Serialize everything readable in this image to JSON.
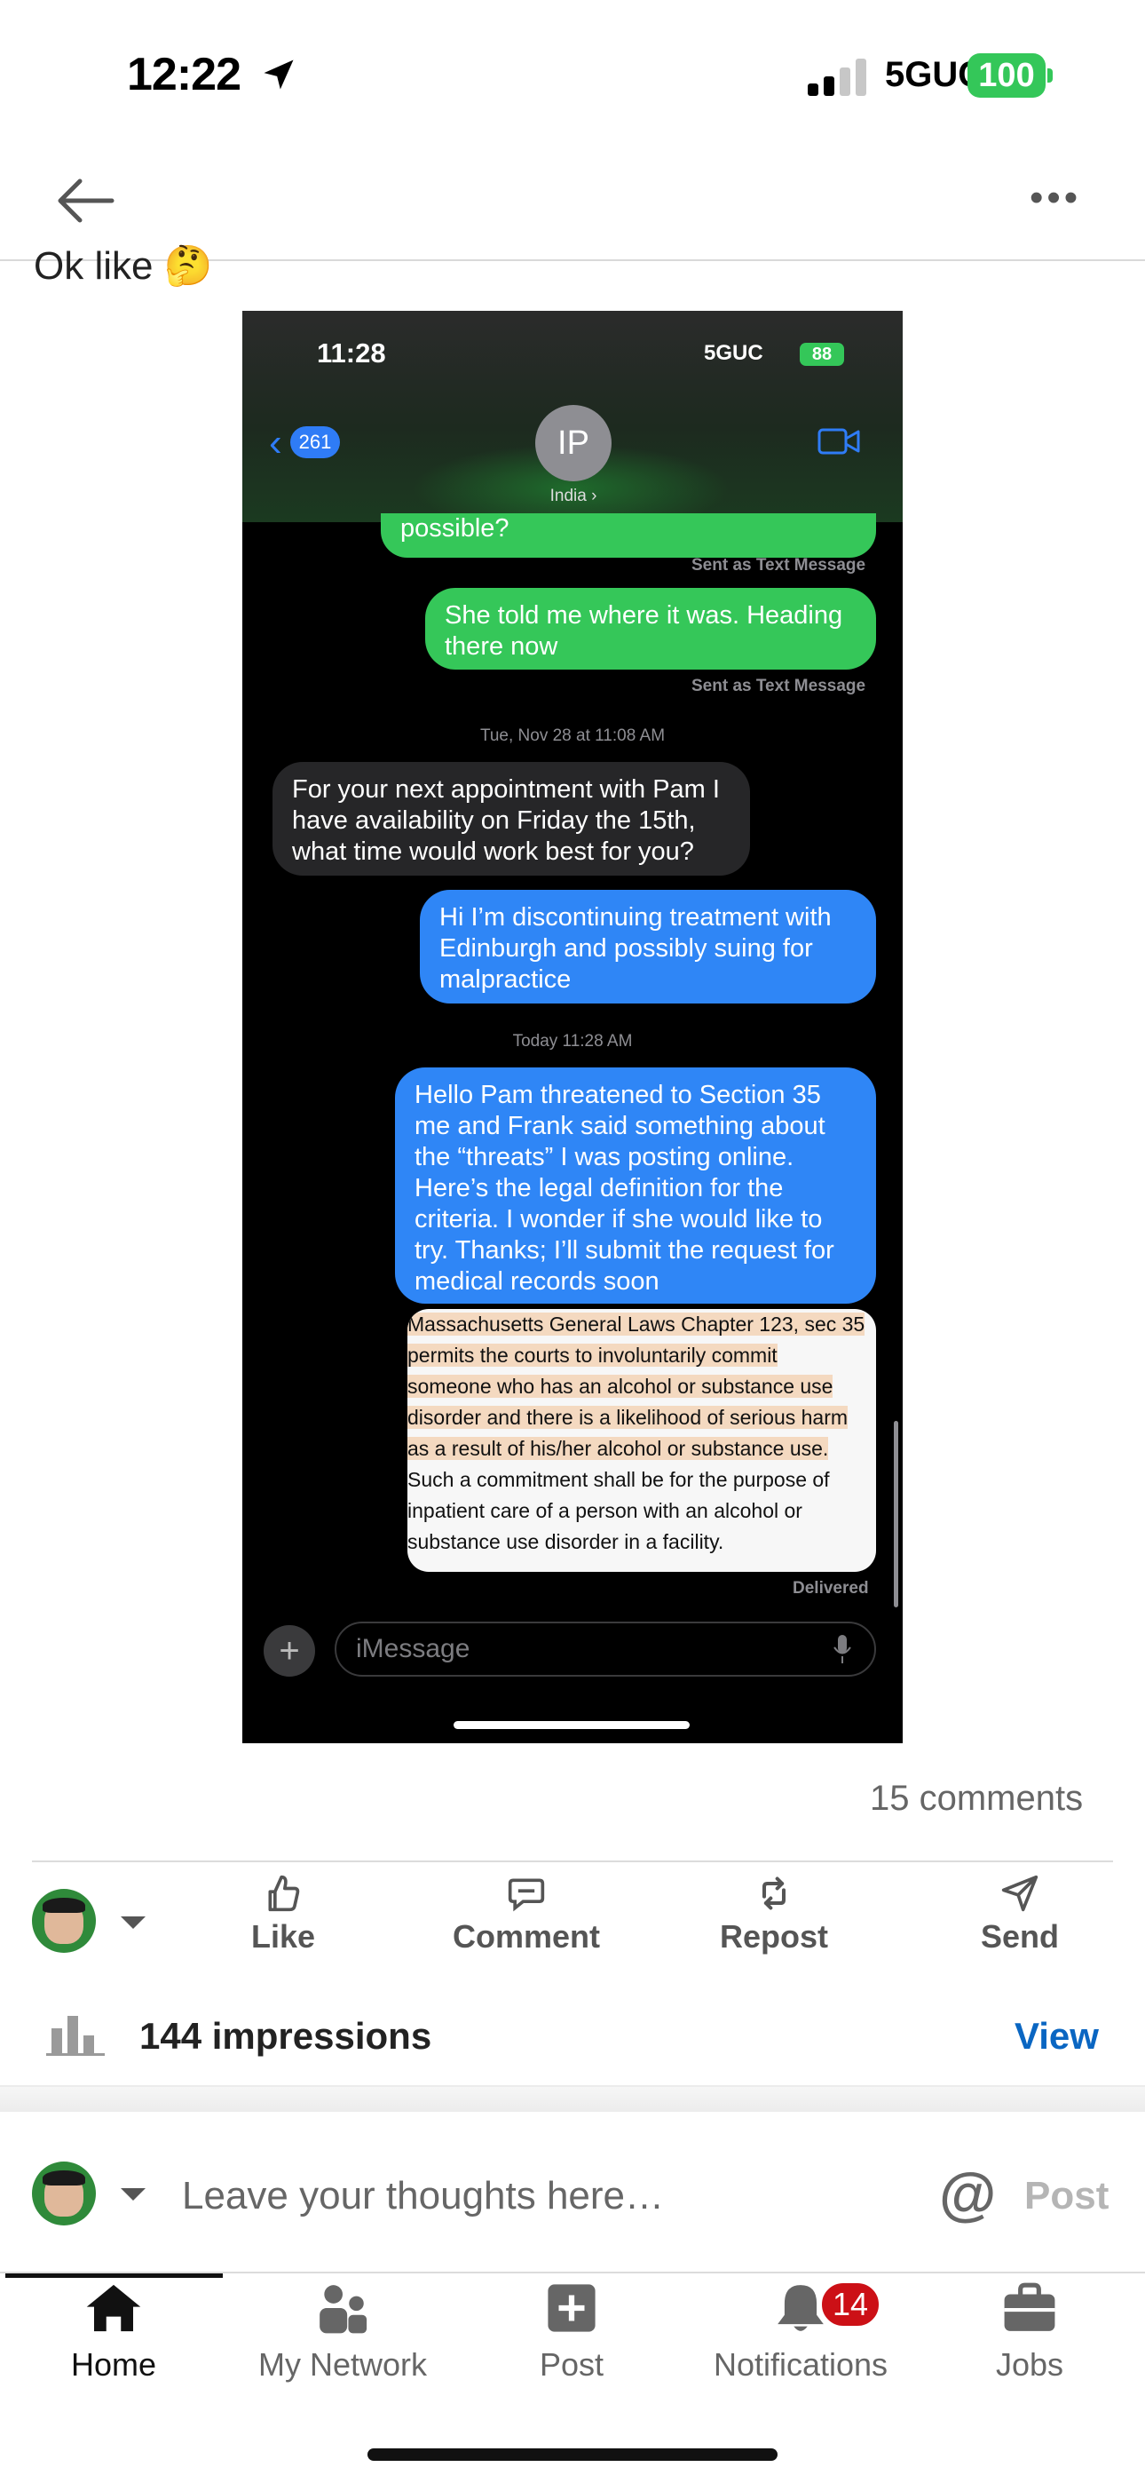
{
  "status_bar": {
    "time": "12:22",
    "network": "5GUC",
    "battery": "100"
  },
  "post": {
    "text": "Ok like",
    "text_emoji": "🤔"
  },
  "screenshot": {
    "status": {
      "time": "11:28",
      "network": "5GUC",
      "battery": "88"
    },
    "back_count": "261",
    "contact_initials": "IP",
    "contact_name": "India ›",
    "messages": [
      {
        "type": "sent-sms",
        "text": "possible?"
      },
      {
        "type": "meta",
        "text": "Sent as Text Message"
      },
      {
        "type": "sent-sms",
        "text": "She told me where it was. Heading there now"
      },
      {
        "type": "meta",
        "text": "Sent as Text Message"
      },
      {
        "type": "timestamp",
        "text": "Tue, Nov 28 at 11:08 AM"
      },
      {
        "type": "received",
        "text": "For your next appointment with Pam I have availability on Friday the 15th, what time would work best for you?"
      },
      {
        "type": "sent-imessage",
        "text": "Hi I’m discontinuing treatment with Edinburgh and possibly suing for malpractice"
      },
      {
        "type": "timestamp",
        "text": "Today 11:28 AM"
      },
      {
        "type": "sent-imessage",
        "text": "Hello Pam threatened to Section 35 me and Frank said something about the “threats” I was posting online. Here’s the legal definition for the criteria. I wonder if she would like to try. Thanks; I’ll submit the request for medical records soon"
      }
    ],
    "document_lines": [
      {
        "text": "Massachusetts General Laws Chapter 123, sec 35",
        "highlight": true
      },
      {
        "text": "permits the courts to involuntarily commit",
        "highlight": true
      },
      {
        "text": "someone who has an alcohol or substance use",
        "highlight": true
      },
      {
        "text": "disorder and there is a likelihood of serious harm",
        "highlight": true
      },
      {
        "text": "as a result of his/her alcohol or substance use.",
        "highlight": true
      },
      {
        "text": "Such a commitment shall be for the purpose of",
        "highlight": false
      },
      {
        "text": "inpatient care of a person with an alcohol or",
        "highlight": false
      },
      {
        "text": "substance use disorder in a facility.",
        "highlight": false
      }
    ],
    "delivered": "Delivered",
    "input_placeholder": "iMessage"
  },
  "comments_count": "15 comments",
  "actions": {
    "like": "Like",
    "comment": "Comment",
    "repost": "Repost",
    "send": "Send"
  },
  "impressions": {
    "label": "144 impressions",
    "view": "View"
  },
  "composer": {
    "placeholder": "Leave your thoughts here…",
    "mention": "@",
    "post": "Post"
  },
  "tabs": [
    {
      "label": "Home",
      "icon": "home-icon",
      "active": true
    },
    {
      "label": "My Network",
      "icon": "network-icon"
    },
    {
      "label": "Post",
      "icon": "post-plus-icon"
    },
    {
      "label": "Notifications",
      "icon": "bell-icon",
      "badge": "14"
    },
    {
      "label": "Jobs",
      "icon": "briefcase-icon"
    }
  ],
  "colors": {
    "accent": "#0a66c2",
    "imessage_blue": "#2f86f6",
    "sms_green": "#35c759",
    "badge_red": "#cc1016"
  }
}
